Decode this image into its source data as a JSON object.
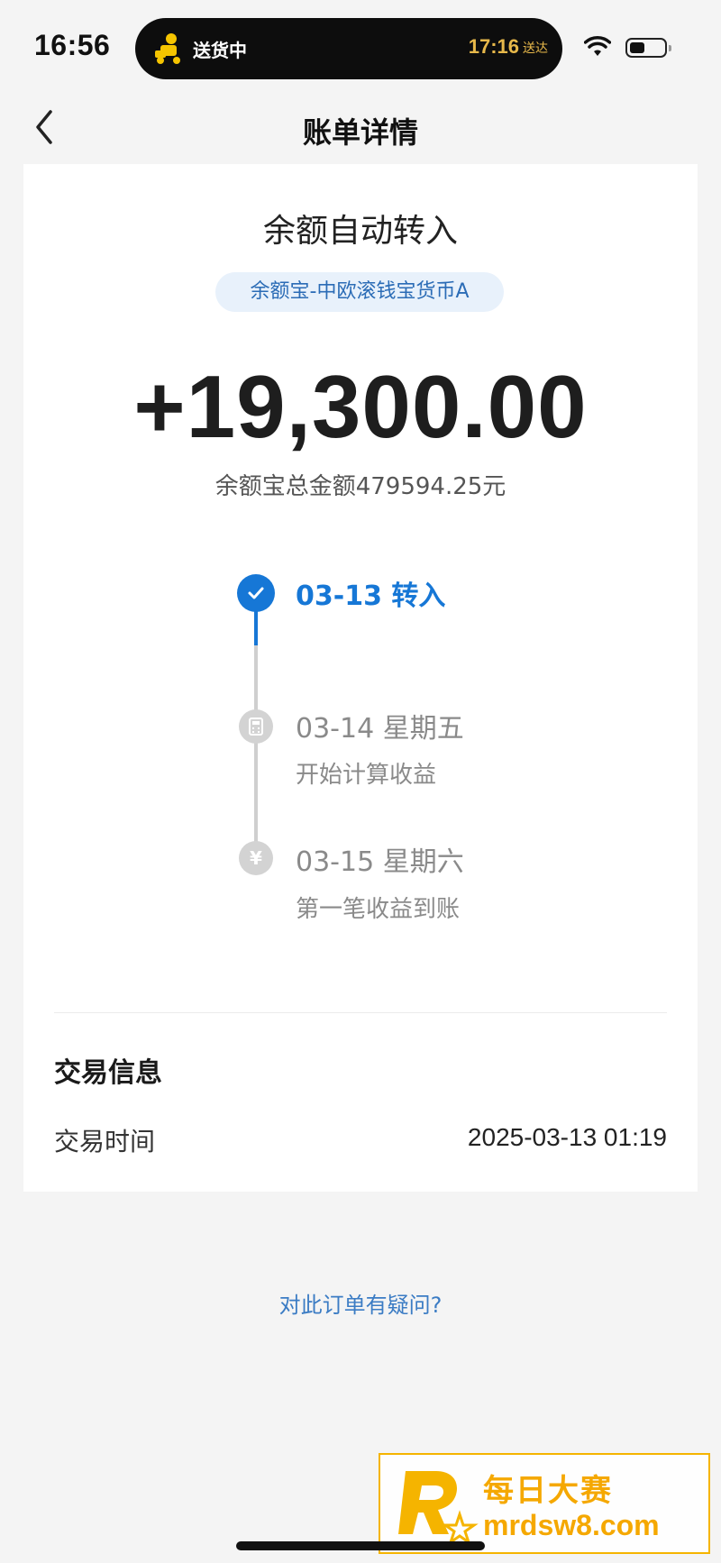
{
  "status_bar": {
    "time": "16:56",
    "activity": {
      "label": "送货中",
      "eta_time": "17:16",
      "eta_suffix": "送达",
      "icon": "delivery-rider-icon"
    },
    "icons": [
      "wifi-icon",
      "battery-icon"
    ],
    "battery_level": 0.45
  },
  "nav": {
    "title": "账单详情",
    "back_icon": "chevron-left-icon"
  },
  "transaction": {
    "title": "余额自动转入",
    "fund_tag": "余额宝-中欧滚钱宝货币A",
    "amount": "+19,300.00",
    "balance_line": "余额宝总金额479594.25元"
  },
  "timeline": [
    {
      "title": "03-13 转入",
      "subtitle": "",
      "state": "active",
      "icon": "check-icon"
    },
    {
      "title": "03-14 星期五",
      "subtitle": "开始计算收益",
      "state": "pending",
      "icon": "calculator-icon"
    },
    {
      "title": "03-15 星期六",
      "subtitle": "第一笔收益到账",
      "state": "pending",
      "icon": "yen-icon"
    }
  ],
  "info": {
    "heading": "交易信息",
    "rows": [
      {
        "label": "交易时间",
        "value": "2025-03-13 01:19"
      }
    ]
  },
  "question_link": "对此订单有疑问?",
  "watermark": {
    "brand_text": "每日大赛",
    "url": "mrdsw8.com"
  },
  "colors": {
    "accent": "#1677d6",
    "pending": "#cfcfcf",
    "link": "#3b7cc4",
    "watermark": "#f5a800"
  }
}
